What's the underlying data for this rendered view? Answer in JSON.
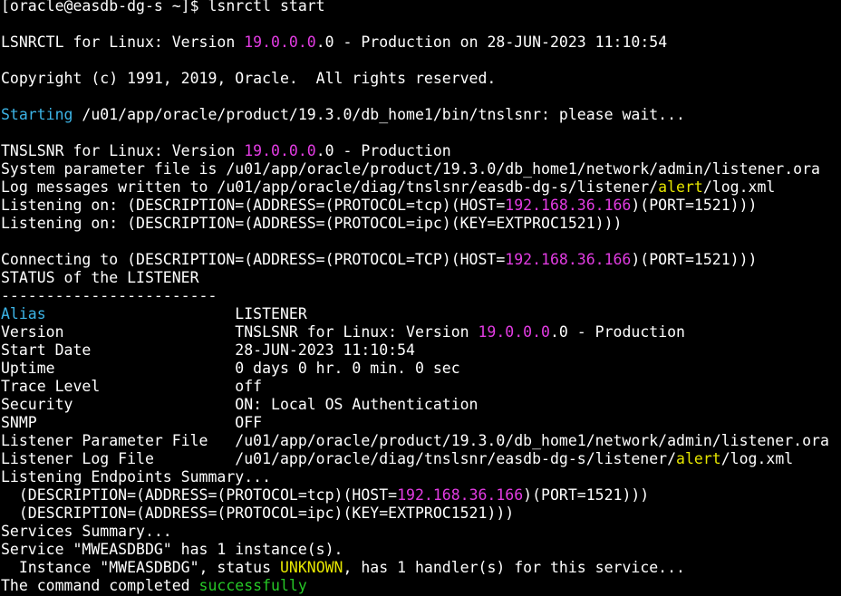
{
  "colors": {
    "background": "#000000",
    "default": "#ffffff",
    "cyan": "#3cb4e6",
    "magenta": "#e23ce2",
    "yellow": "#e6e600",
    "green": "#26c826"
  },
  "terminal": {
    "lines": [
      [
        {
          "t": "[oracle@easdb-dg-s ~]$ lsnrctl start"
        }
      ],
      [],
      [
        {
          "t": "LSNRCTL for Linux: Version "
        },
        {
          "t": "19.0.0.0",
          "c": "magenta"
        },
        {
          "t": ".0 - Production on 28-JUN-2023 11:10:54"
        }
      ],
      [],
      [
        {
          "t": "Copyright (c) 1991, 2019, Oracle.  All rights reserved."
        }
      ],
      [],
      [
        {
          "t": "Starting",
          "c": "cyan"
        },
        {
          "t": " /u01/app/oracle/product/19.3.0/db_home1/bin/tnslsnr: please wait..."
        }
      ],
      [],
      [
        {
          "t": "TNSLSNR for Linux: Version "
        },
        {
          "t": "19.0.0.0",
          "c": "magenta"
        },
        {
          "t": ".0 - Production"
        }
      ],
      [
        {
          "t": "System parameter file is /u01/app/oracle/product/19.3.0/db_home1/network/admin/listener.ora"
        }
      ],
      [
        {
          "t": "Log messages written to /u01/app/oracle/diag/tnslsnr/easdb-dg-s/listener/"
        },
        {
          "t": "alert",
          "c": "yellow"
        },
        {
          "t": "/log.xml"
        }
      ],
      [
        {
          "t": "Listening on: (DESCRIPTION=(ADDRESS=(PROTOCOL=tcp)(HOST="
        },
        {
          "t": "192.168.36.166",
          "c": "magenta"
        },
        {
          "t": ")(PORT=1521)))"
        }
      ],
      [
        {
          "t": "Listening on: (DESCRIPTION=(ADDRESS=(PROTOCOL=ipc)(KEY=EXTPROC1521)))"
        }
      ],
      [],
      [
        {
          "t": "Connecting to (DESCRIPTION=(ADDRESS=(PROTOCOL=TCP)(HOST="
        },
        {
          "t": "192.168.36.166",
          "c": "magenta"
        },
        {
          "t": ")(PORT=1521)))"
        }
      ],
      [
        {
          "t": "STATUS of the LISTENER"
        }
      ],
      [
        {
          "t": "------------------------"
        }
      ],
      [
        {
          "t": "Alias",
          "c": "cyan"
        },
        {
          "t": "                     LISTENER"
        }
      ],
      [
        {
          "t": "Version                   TNSLSNR for Linux: Version "
        },
        {
          "t": "19.0.0.0",
          "c": "magenta"
        },
        {
          "t": ".0 - Production"
        }
      ],
      [
        {
          "t": "Start Date                28-JUN-2023 11:10:54"
        }
      ],
      [
        {
          "t": "Uptime                    0 days 0 hr. 0 min. 0 sec"
        }
      ],
      [
        {
          "t": "Trace Level               off"
        }
      ],
      [
        {
          "t": "Security                  ON: Local OS Authentication"
        }
      ],
      [
        {
          "t": "SNMP                      OFF"
        }
      ],
      [
        {
          "t": "Listener Parameter File   /u01/app/oracle/product/19.3.0/db_home1/network/admin/listener.ora"
        }
      ],
      [
        {
          "t": "Listener Log File         /u01/app/oracle/diag/tnslsnr/easdb-dg-s/listener/"
        },
        {
          "t": "alert",
          "c": "yellow"
        },
        {
          "t": "/log.xml"
        }
      ],
      [
        {
          "t": "Listening Endpoints Summary..."
        }
      ],
      [
        {
          "t": "  (DESCRIPTION=(ADDRESS=(PROTOCOL=tcp)(HOST="
        },
        {
          "t": "192.168.36.166",
          "c": "magenta"
        },
        {
          "t": ")(PORT=1521)))"
        }
      ],
      [
        {
          "t": "  (DESCRIPTION=(ADDRESS=(PROTOCOL=ipc)(KEY=EXTPROC1521)))"
        }
      ],
      [
        {
          "t": "Services Summary..."
        }
      ],
      [
        {
          "t": "Service \"MWEASDBDG\" has 1 instance(s)."
        }
      ],
      [
        {
          "t": "  Instance \"MWEASDBDG\", status "
        },
        {
          "t": "UNKNOWN",
          "c": "yellow"
        },
        {
          "t": ", has 1 handler(s) for this service..."
        }
      ],
      [
        {
          "t": "The command completed "
        },
        {
          "t": "successfully",
          "c": "green"
        }
      ]
    ]
  }
}
